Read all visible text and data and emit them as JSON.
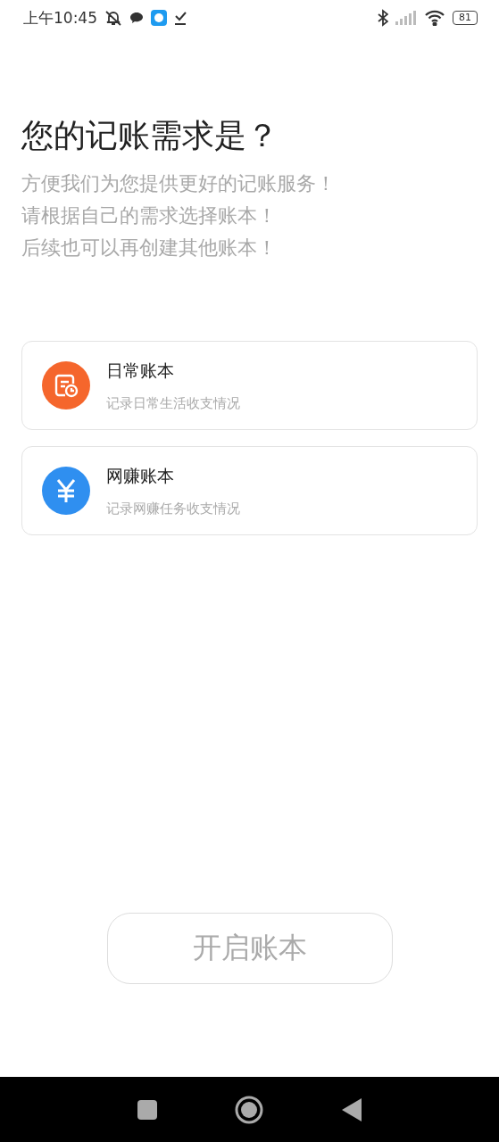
{
  "status_bar": {
    "time": "上午10:45",
    "battery": "81"
  },
  "title": "您的记账需求是？",
  "subtitle_lines": [
    "方便我们为您提供更好的记账服务！",
    "请根据自己的需求选择账本！",
    "后续也可以再创建其他账本！"
  ],
  "books": [
    {
      "kind": "daily",
      "name": "日常账本",
      "description": "记录日常生活收支情况",
      "color": "#f5662c",
      "selected": false
    },
    {
      "kind": "money",
      "name": "网赚账本",
      "description": "记录网赚任务收支情况",
      "color": "#2f8ff0",
      "selected": false
    }
  ],
  "start_button": {
    "label": "开启账本",
    "disabled": true
  }
}
